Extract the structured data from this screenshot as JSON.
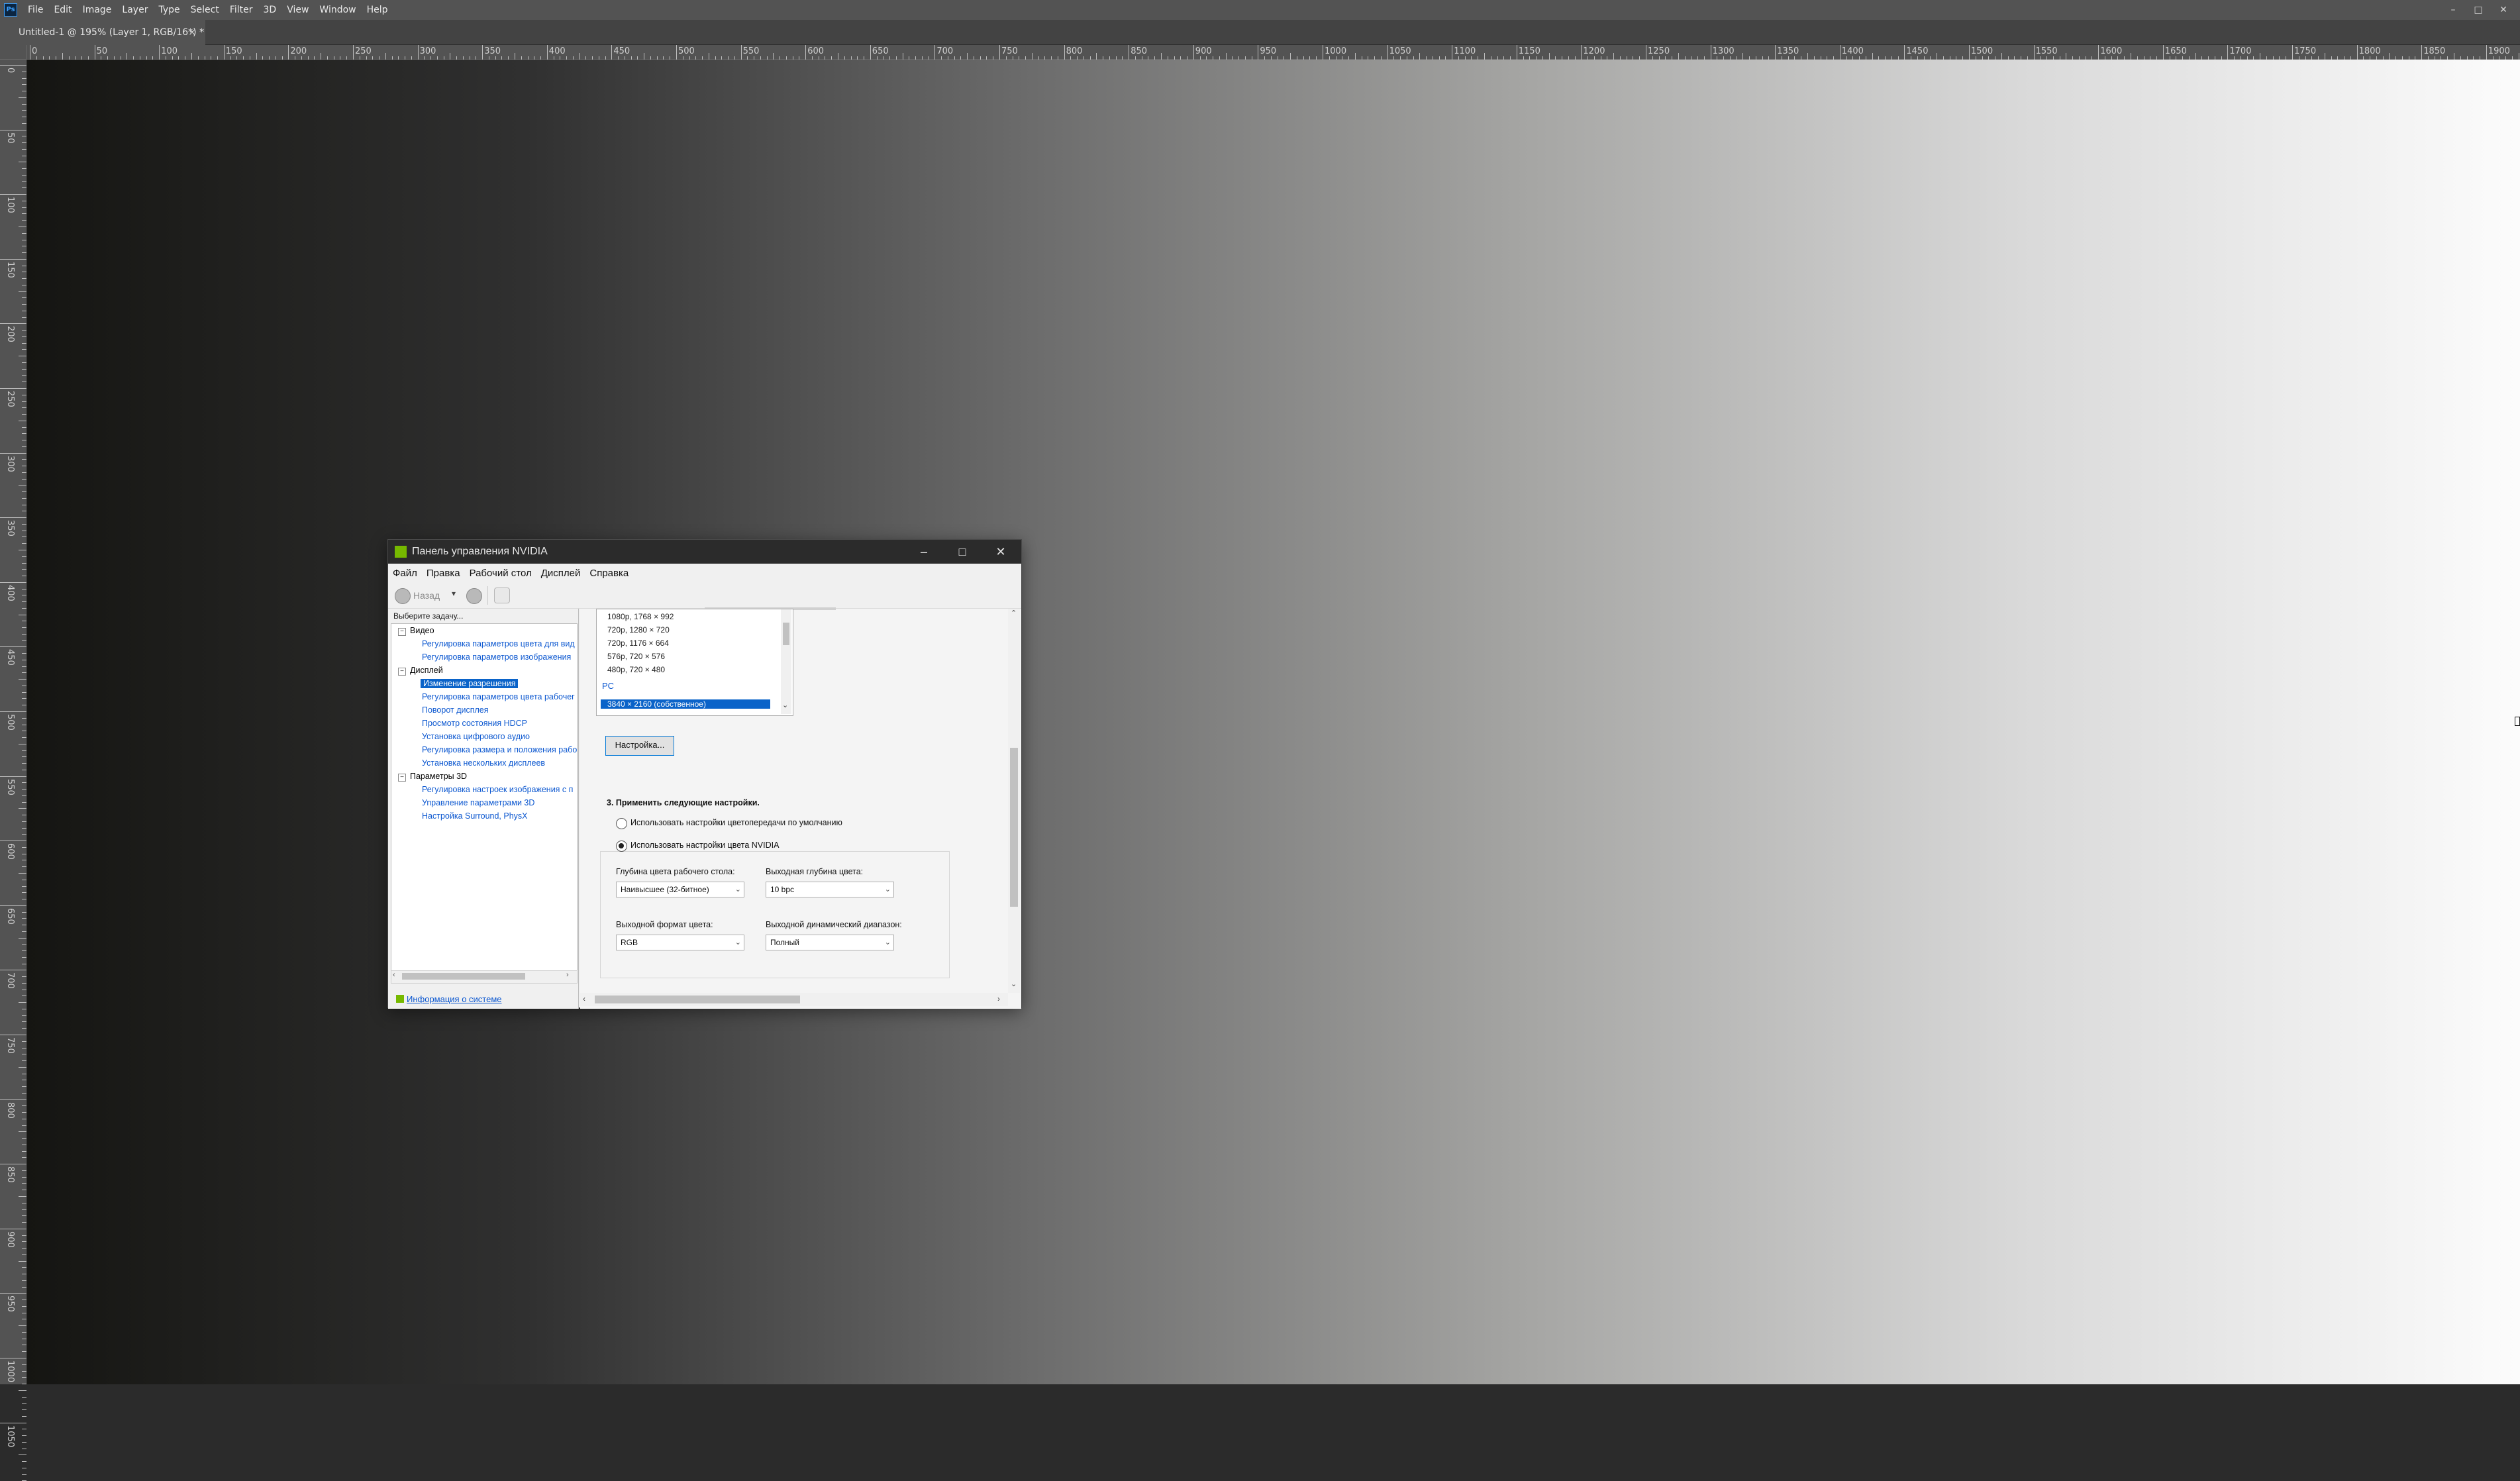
{
  "app": {
    "menu": [
      "File",
      "Edit",
      "Image",
      "Layer",
      "Type",
      "Select",
      "Filter",
      "3D",
      "View",
      "Window",
      "Help"
    ],
    "logo": "Ps",
    "window_controls": [
      "–",
      "□",
      "✕"
    ],
    "document_tab": "Untitled-1 @ 195% (Layer 1, RGB/16*) *",
    "document_tab_close": "×"
  },
  "rulers": {
    "horizontal": [
      "0",
      "50",
      "100",
      "150",
      "200",
      "250",
      "300",
      "350",
      "400",
      "450",
      "500",
      "550",
      "600",
      "650",
      "700",
      "750",
      "800",
      "850",
      "900",
      "950",
      "1000",
      "1050",
      "1100",
      "1150",
      "1200",
      "1250",
      "1300",
      "1350",
      "1400",
      "1450",
      "1500",
      "1550",
      "1600",
      "1650",
      "1700",
      "1750",
      "1800",
      "1850",
      "1900"
    ],
    "vertical": [
      "0",
      "50",
      "100",
      "150",
      "200",
      "250",
      "300",
      "350",
      "400",
      "450",
      "500",
      "550",
      "600",
      "650",
      "700",
      "750",
      "800",
      "850",
      "900",
      "950",
      "1000",
      "1050"
    ]
  },
  "nvidia": {
    "title": "Панель управления NVIDIA",
    "title_controls": [
      "–",
      "□",
      "✕"
    ],
    "menu": [
      "Файл",
      "Правка",
      "Рабочий стол",
      "Дисплей",
      "Справка"
    ],
    "toolbar": {
      "back_label": "Назад"
    },
    "task_header": "Выберите задачу...",
    "tree": [
      {
        "type": "cat",
        "label": "Видео"
      },
      {
        "type": "link",
        "label": "Регулировка параметров цвета для вид"
      },
      {
        "type": "link",
        "label": "Регулировка параметров изображения"
      },
      {
        "type": "cat",
        "label": "Дисплей"
      },
      {
        "type": "selected",
        "label": "Изменение разрешения"
      },
      {
        "type": "link",
        "label": "Регулировка параметров цвета рабочег"
      },
      {
        "type": "link",
        "label": "Поворот дисплея"
      },
      {
        "type": "link",
        "label": "Просмотр состояния HDCP"
      },
      {
        "type": "link",
        "label": "Установка цифрового аудио"
      },
      {
        "type": "link",
        "label": "Регулировка размера и положения рабо"
      },
      {
        "type": "link",
        "label": "Установка нескольких дисплеев"
      },
      {
        "type": "cat",
        "label": "Параметры 3D"
      },
      {
        "type": "link",
        "label": "Регулировка настроек изображения с п"
      },
      {
        "type": "link",
        "label": "Управление параметрами 3D"
      },
      {
        "type": "link",
        "label": "Настройка Surround, PhysX"
      }
    ],
    "system_info": "Информация о системе",
    "resolutions": [
      "1080p, 1768 × 992",
      "720p, 1280 × 720",
      "720p, 1176 × 664",
      "576p, 720 × 576",
      "480p, 720 × 480"
    ],
    "pc_label": "PC",
    "selected_resolution": "3840 × 2160 (собственное)",
    "customize_button": "Настройка...",
    "section3_title": "3. Применить следующие настройки.",
    "radio_default": "Использовать настройки цветопередачи по умолчанию",
    "radio_nvidia": "Использовать настройки цвета NVIDIA",
    "desktop_depth_label": "Глубина цвета рабочего стола:",
    "desktop_depth_value": "Наивысшее (32-битное)",
    "output_depth_label": "Выходная глубина цвета:",
    "output_depth_value": "10 bpc",
    "output_format_label": "Выходной формат цвета:",
    "output_format_value": "RGB",
    "dynamic_range_label": "Выходной динамический диапазон:",
    "dynamic_range_value": "Полный"
  }
}
